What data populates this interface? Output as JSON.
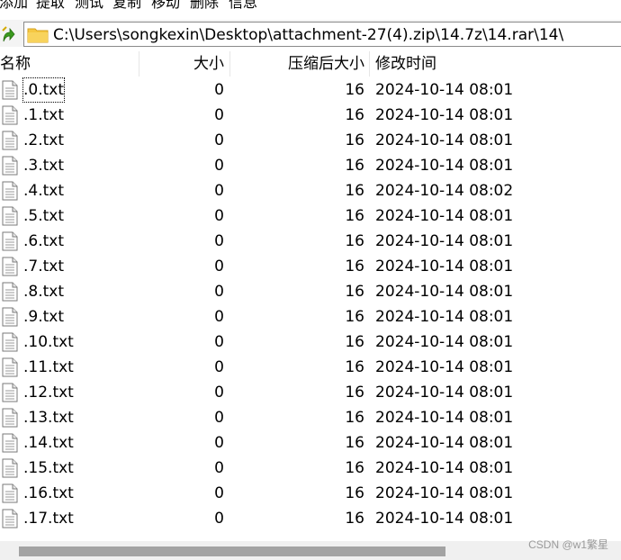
{
  "toolbar": {
    "buttons": [
      "添加",
      "提取",
      "测试",
      "复制",
      "移动",
      "删除",
      "信息"
    ]
  },
  "address": {
    "path": "C:\\Users\\songkexin\\Desktop\\attachment-27(4).zip\\14.7z\\14.rar\\14\\"
  },
  "columns": {
    "name": "名称",
    "size": "大小",
    "packed_size": "压缩后大小",
    "modified": "修改时间"
  },
  "files": [
    {
      "name": ".0.txt",
      "size": "0",
      "packed": "16",
      "modified": "2024-10-14 08:01"
    },
    {
      "name": ".1.txt",
      "size": "0",
      "packed": "16",
      "modified": "2024-10-14 08:01"
    },
    {
      "name": ".2.txt",
      "size": "0",
      "packed": "16",
      "modified": "2024-10-14 08:01"
    },
    {
      "name": ".3.txt",
      "size": "0",
      "packed": "16",
      "modified": "2024-10-14 08:01"
    },
    {
      "name": ".4.txt",
      "size": "0",
      "packed": "16",
      "modified": "2024-10-14 08:02"
    },
    {
      "name": ".5.txt",
      "size": "0",
      "packed": "16",
      "modified": "2024-10-14 08:01"
    },
    {
      "name": ".6.txt",
      "size": "0",
      "packed": "16",
      "modified": "2024-10-14 08:01"
    },
    {
      "name": ".7.txt",
      "size": "0",
      "packed": "16",
      "modified": "2024-10-14 08:01"
    },
    {
      "name": ".8.txt",
      "size": "0",
      "packed": "16",
      "modified": "2024-10-14 08:01"
    },
    {
      "name": ".9.txt",
      "size": "0",
      "packed": "16",
      "modified": "2024-10-14 08:01"
    },
    {
      "name": ".10.txt",
      "size": "0",
      "packed": "16",
      "modified": "2024-10-14 08:01"
    },
    {
      "name": ".11.txt",
      "size": "0",
      "packed": "16",
      "modified": "2024-10-14 08:01"
    },
    {
      "name": ".12.txt",
      "size": "0",
      "packed": "16",
      "modified": "2024-10-14 08:01"
    },
    {
      "name": ".13.txt",
      "size": "0",
      "packed": "16",
      "modified": "2024-10-14 08:01"
    },
    {
      "name": ".14.txt",
      "size": "0",
      "packed": "16",
      "modified": "2024-10-14 08:01"
    },
    {
      "name": ".15.txt",
      "size": "0",
      "packed": "16",
      "modified": "2024-10-14 08:01"
    },
    {
      "name": ".16.txt",
      "size": "0",
      "packed": "16",
      "modified": "2024-10-14 08:01"
    },
    {
      "name": ".17.txt",
      "size": "0",
      "packed": "16",
      "modified": "2024-10-14 08:01"
    }
  ],
  "icons": {
    "up": "up-arrow-icon",
    "folder": "folder-icon",
    "file": "text-file-icon"
  },
  "colors": {
    "folder": "#f5c842",
    "up_arrow": "#3a9a1e",
    "scroll_thumb": "#a3a3a3"
  },
  "watermark": "CSDN @w1繁星"
}
